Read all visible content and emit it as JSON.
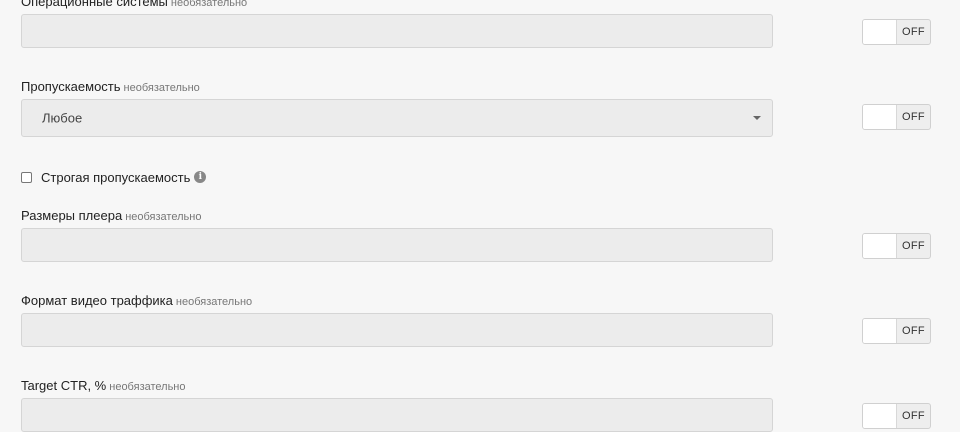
{
  "optional_text": "необязательно",
  "toggle_state": "OFF",
  "fields": {
    "os": {
      "label": "Операционные системы"
    },
    "throughput": {
      "label": "Пропускаемость",
      "selected": "Любое"
    },
    "player_size": {
      "label": "Размеры плеера"
    },
    "video_format": {
      "label": "Формат видео траффика"
    },
    "target_ctr": {
      "label": "Target CTR, %"
    }
  },
  "strict_throughput": {
    "label": "Строгая пропускаемость",
    "checked": false
  },
  "icons": {
    "info": "info-icon",
    "caret": "chevron-down-icon"
  }
}
